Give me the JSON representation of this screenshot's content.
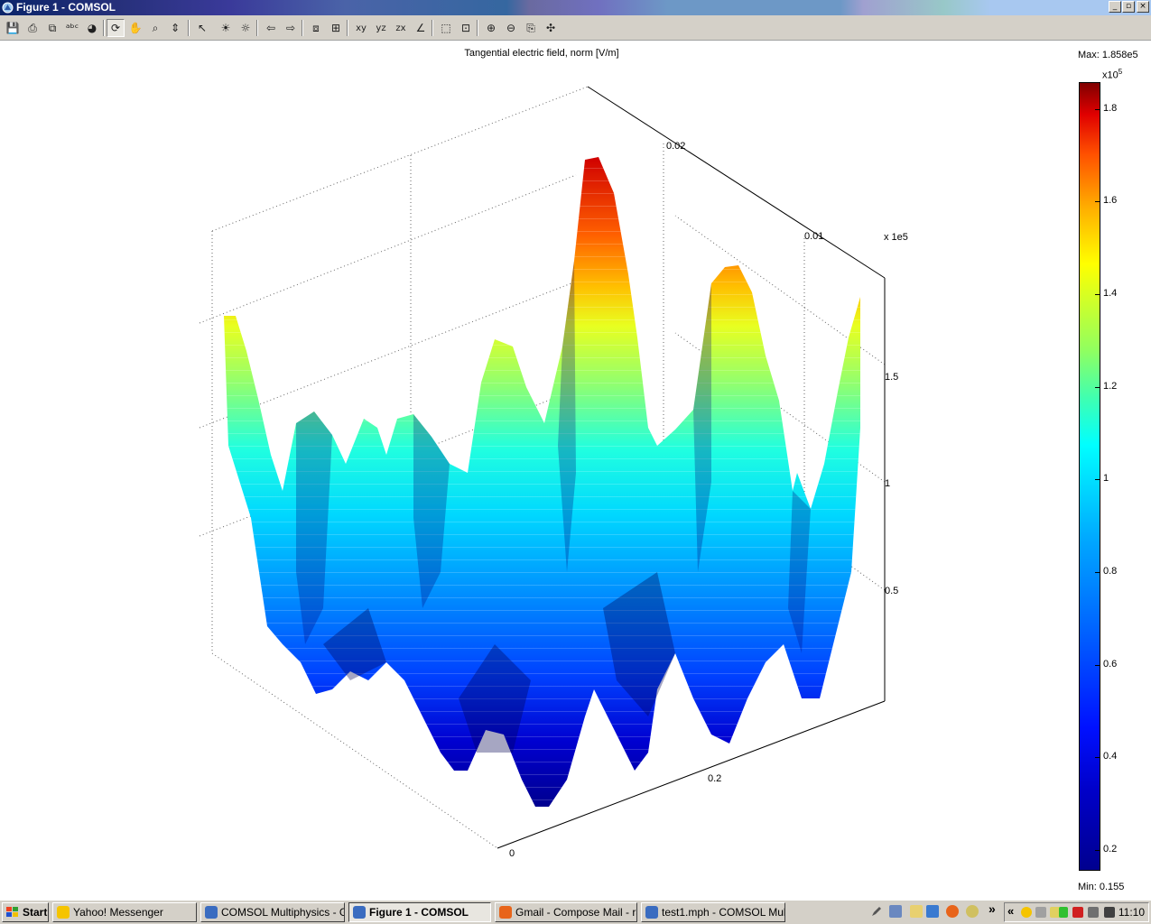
{
  "window": {
    "title": "Figure 1 - COMSOL",
    "minimize": "_",
    "restore": "▫",
    "close": "×"
  },
  "toolbar": {
    "buttons": [
      {
        "name": "save-icon",
        "glyph": "💾"
      },
      {
        "name": "print-icon",
        "glyph": "⎙"
      },
      {
        "name": "copy-icon",
        "glyph": "⧉"
      },
      {
        "name": "abc-text-icon",
        "glyph": "ᵃᵇᶜ"
      },
      {
        "name": "palette-icon",
        "glyph": "◕"
      },
      {
        "name": "rotate-icon",
        "glyph": "⟳"
      },
      {
        "name": "pan-icon",
        "glyph": "✋"
      },
      {
        "name": "zoom-icon",
        "glyph": "⌕"
      },
      {
        "name": "move-icon",
        "glyph": "⇕"
      },
      {
        "name": "select-icon",
        "glyph": "↖"
      },
      {
        "name": "light-icon",
        "glyph": "☀"
      },
      {
        "name": "headlight-icon",
        "glyph": "☼"
      },
      {
        "name": "arrow-left-icon",
        "glyph": "⇦"
      },
      {
        "name": "arrow-right-icon",
        "glyph": "⇨"
      },
      {
        "name": "box-view-icon",
        "glyph": "⧈"
      },
      {
        "name": "cube-view-icon",
        "glyph": "⊞"
      },
      {
        "name": "xy-view-icon",
        "glyph": "xy"
      },
      {
        "name": "yz-view-icon",
        "glyph": "yz"
      },
      {
        "name": "zx-view-icon",
        "glyph": "zx"
      },
      {
        "name": "axes-icon",
        "glyph": "∠"
      },
      {
        "name": "zoom-box-icon",
        "glyph": "⬚"
      },
      {
        "name": "zoom-extents-icon",
        "glyph": "⊡"
      },
      {
        "name": "zoom-in-icon",
        "glyph": "⊕"
      },
      {
        "name": "zoom-out-icon",
        "glyph": "⊖"
      },
      {
        "name": "camera-icon",
        "glyph": "⎘"
      },
      {
        "name": "orbit-icon",
        "glyph": "✣"
      }
    ]
  },
  "plot": {
    "title": "Tangential electric field, norm [V/m]",
    "axis_labels": [
      {
        "name": "x-tick-0-02",
        "text": "0.02"
      },
      {
        "name": "x-tick-0-01",
        "text": "0.01"
      },
      {
        "name": "z-scale",
        "text": "x 1e5"
      },
      {
        "name": "z-tick-1-5",
        "text": "1.5"
      },
      {
        "name": "z-tick-1",
        "text": "1"
      },
      {
        "name": "z-tick-0-5",
        "text": "0.5"
      },
      {
        "name": "y-tick-0-2",
        "text": "0.2"
      },
      {
        "name": "y-tick-0",
        "text": "0"
      }
    ]
  },
  "chart_data": {
    "type": "surface",
    "title": "Tangential electric field, norm [V/m]",
    "z_scale": "x 1e5",
    "x_ticks": [
      "0.02",
      "0.01"
    ],
    "y_ticks": [
      "0",
      "0.2"
    ],
    "z_ticks": [
      "0.5",
      "1",
      "1.5"
    ],
    "z_range": [
      0.155,
      1.858
    ],
    "peaks": [
      {
        "peak": 1.78,
        "color_level": "red"
      },
      {
        "peak": 1.55,
        "color_level": "orange"
      },
      {
        "peak": 1.85,
        "color_level": "red"
      },
      {
        "peak": 1.7,
        "color_level": "red"
      },
      {
        "peak": 1.6,
        "color_level": "orange"
      }
    ]
  },
  "colorbar": {
    "max_label": "Max: 1.858e5",
    "exponent": "x10",
    "exponent_power": "5",
    "ticks": [
      "1.8",
      "1.6",
      "1.4",
      "1.2",
      "1",
      "0.8",
      "0.6",
      "0.4",
      "0.2"
    ],
    "min_label": "Min: 0.155",
    "range": [
      0.155,
      1.858
    ]
  },
  "taskbar": {
    "start_label": "Start",
    "tasks": [
      {
        "name": "task-yahoo-messenger",
        "label": "Yahoo! Messenger",
        "color": "#f5c400"
      },
      {
        "name": "task-comsol-multiphysics",
        "label": "COMSOL Multiphysics - G...",
        "color": "#3a6cc0"
      },
      {
        "name": "task-figure-1-comsol",
        "label": "Figure 1 - COMSOL",
        "color": "#3a6cc0",
        "active": true
      },
      {
        "name": "task-gmail-compose",
        "label": "Gmail - Compose Mail - ra...",
        "color": "#e8641a"
      },
      {
        "name": "task-test1-mph",
        "label": "test1.mph - COMSOL Mul...",
        "color": "#3a6cc0"
      }
    ],
    "overflow": "»",
    "tray_overflow": "«",
    "clock": "11:10"
  }
}
